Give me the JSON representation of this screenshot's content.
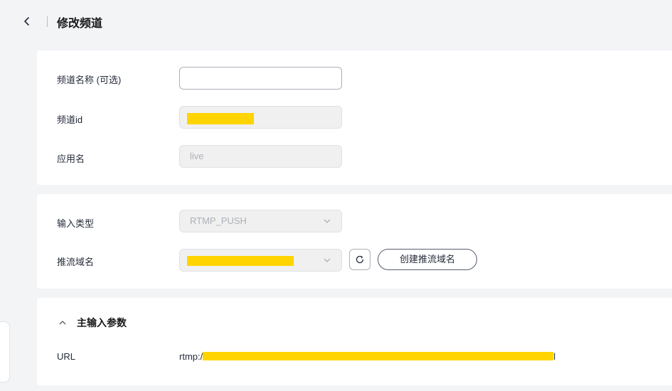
{
  "header": {
    "title": "修改频道"
  },
  "basic": {
    "channel_name_label": "频道名称 (可选)",
    "channel_name_value": "",
    "channel_id_label": "频道id",
    "app_name_label": "应用名",
    "app_name_value": "live"
  },
  "input_config": {
    "input_type_label": "输入类型",
    "input_type_value": "RTMP_PUSH",
    "push_domain_label": "推流域名",
    "create_domain_button": "创建推流域名"
  },
  "main_input": {
    "section_title": "主输入参数",
    "url_label": "URL",
    "url_prefix": "rtmp:/",
    "url_suffix": "l"
  },
  "colors": {
    "redaction": "#ffd400",
    "background": "#f3f4f6"
  }
}
